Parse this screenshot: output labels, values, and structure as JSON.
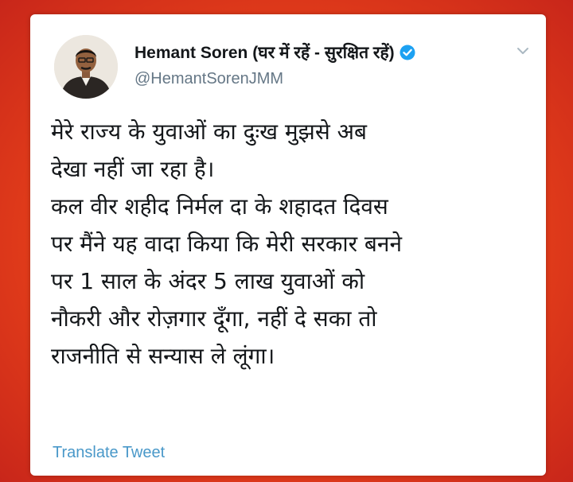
{
  "tweet": {
    "author_name": "Hemant Soren (घर में रहें - सुरक्षित रहें)",
    "handle": "@HemantSorenJMM",
    "text": "मेरे राज्य के युवाओं का दुःख मुझसे अब\nदेखा नहीं जा रहा है।\nकल वीर शहीद निर्मल दा के शहादत दिवस\nपर मैंने यह वादा किया कि मेरी सरकार बनने\nपर 1 साल के अंदर 5 लाख युवाओं को\nनौकरी और रोज़गार दूँगा, नहीं दे सका तो\nराजनीति से सन्यास ले लूंगा।",
    "translate_label": "Translate Tweet"
  },
  "icons": {
    "verified": "verified-badge-icon",
    "menu": "chevron-down-icon",
    "avatar": "profile-photo"
  },
  "colors": {
    "background": "#e8401a",
    "card": "#ffffff",
    "verified": "#1da1f2",
    "link": "#1da1f2",
    "handle": "#657786",
    "text": "#14171a"
  }
}
